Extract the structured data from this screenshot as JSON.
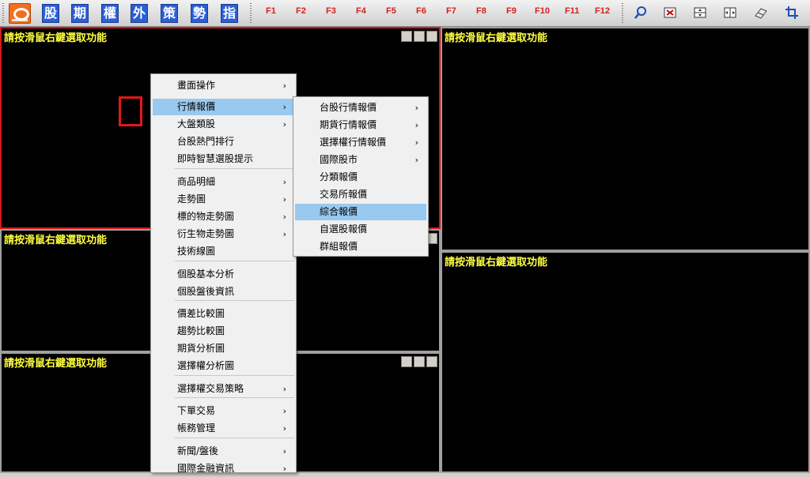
{
  "toolbar": {
    "quick_buttons": [
      "股",
      "期",
      "權",
      "外",
      "策",
      "勢",
      "指"
    ],
    "function_keys": [
      "F1",
      "F2",
      "F3",
      "F4",
      "F5",
      "F6",
      "F7",
      "F8",
      "F9",
      "F10",
      "F11",
      "F12"
    ],
    "tools": [
      "search-icon",
      "close-window-icon",
      "split-horizontal-icon",
      "split-vertical-icon",
      "eraser-icon",
      "crop-icon"
    ]
  },
  "pane_prompt": "請按滑鼠右鍵選取功能",
  "context_menu": {
    "items": [
      {
        "label": "畫面操作",
        "submenu": true
      },
      {
        "label": "行情報價",
        "submenu": true,
        "selected": true
      },
      {
        "label": "大盤類股",
        "submenu": true
      },
      {
        "label": "台股熱門排行",
        "submenu": false
      },
      {
        "label": "即時智慧選股提示",
        "submenu": false
      },
      {
        "label": "商品明細",
        "submenu": true
      },
      {
        "label": "走勢圖",
        "submenu": true
      },
      {
        "label": "標的物走勢圖",
        "submenu": true
      },
      {
        "label": "衍生物走勢圖",
        "submenu": true
      },
      {
        "label": "技術線圖",
        "submenu": false
      },
      {
        "label": "個股基本分析",
        "submenu": false
      },
      {
        "label": "個股盤後資訊",
        "submenu": false
      },
      {
        "label": "價差比較圖",
        "submenu": false
      },
      {
        "label": "趨勢比較圖",
        "submenu": false
      },
      {
        "label": "期貨分析圖",
        "submenu": false
      },
      {
        "label": "選擇權分析圖",
        "submenu": false
      },
      {
        "label": "選擇權交易策略",
        "submenu": true
      },
      {
        "label": "下單交易",
        "submenu": true
      },
      {
        "label": "帳務管理",
        "submenu": true
      },
      {
        "label": "新聞/盤後",
        "submenu": true
      },
      {
        "label": "國際金融資訊",
        "submenu": true
      }
    ]
  },
  "submenu": {
    "items": [
      {
        "label": "台股行情報價",
        "submenu": true
      },
      {
        "label": "期貨行情報價",
        "submenu": true
      },
      {
        "label": "選擇權行情報價",
        "submenu": true
      },
      {
        "label": "國際股市",
        "submenu": true
      },
      {
        "label": "分類報價",
        "submenu": false
      },
      {
        "label": "交易所報價",
        "submenu": false
      },
      {
        "label": "綜合報價",
        "submenu": false,
        "selected": true
      },
      {
        "label": "自選股報價",
        "submenu": false
      },
      {
        "label": "群組報價",
        "submenu": false
      }
    ]
  },
  "arrow_glyph": "›",
  "colors": {
    "prompt_text": "#ffff40",
    "active_border": "#d61a1a",
    "menu_highlight": "#99c9ef",
    "fkey_text": "#d42020"
  }
}
